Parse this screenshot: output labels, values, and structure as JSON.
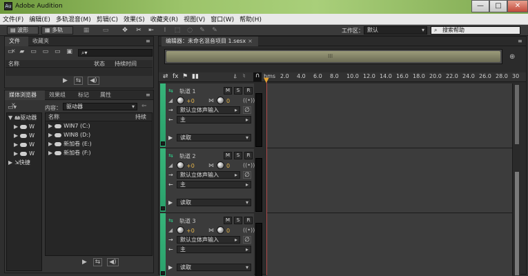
{
  "window": {
    "title": "Adobe Audition",
    "app_icon_text": "Au",
    "controls": [
      "—",
      "□",
      "✕"
    ]
  },
  "menu": [
    "文件(F)",
    "编辑(E)",
    "多轨混音(M)",
    "剪辑(C)",
    "效果(S)",
    "收藏夹(R)",
    "视图(V)",
    "窗口(W)",
    "帮助(H)"
  ],
  "toolbar": {
    "waveform_label": "波形",
    "multitrack_label": "多轨",
    "workspace_label": "工作区：",
    "workspace_value": "默认",
    "search_placeholder": "搜索帮助"
  },
  "files_panel": {
    "tabs": [
      "文件",
      "收藏夹"
    ],
    "columns": {
      "name": "名称",
      "status": "状态",
      "duration": "持续时间"
    }
  },
  "browser_panel": {
    "tabs": [
      "媒体浏览器",
      "效果组",
      "标记",
      "属性"
    ],
    "content_label": "内容：",
    "content_value": "驱动器",
    "left_tree": [
      "驱动器",
      "W",
      "W",
      "W",
      "W",
      "快捷"
    ],
    "columns": {
      "name": "名称",
      "duration": "持续"
    },
    "drives": [
      "WIN7 (C:)",
      "WIN8 (D:)",
      "新加卷 (E:)",
      "新加卷 (F:)"
    ]
  },
  "editor": {
    "tab_label": "编辑器：未命名混音项目 1.sesx",
    "ruler": [
      "hms",
      "2.0",
      "4.0",
      "6.0",
      "8.0",
      "10.0",
      "12.0",
      "14.0",
      "16.0",
      "18.0",
      "20.0",
      "22.0",
      "24.0",
      "26.0",
      "28.0",
      "30"
    ],
    "tracks": [
      {
        "name": "轨道 1",
        "volume": "+0",
        "pan": "0",
        "input": "默认立体声输入",
        "output": "主",
        "read": "读取"
      },
      {
        "name": "轨道 2",
        "volume": "+0",
        "pan": "0",
        "input": "默认立体声输入",
        "output": "主",
        "read": "读取"
      },
      {
        "name": "轨道 3",
        "volume": "+0",
        "pan": "0",
        "input": "默认立体声输入",
        "output": "主",
        "read": "读取"
      }
    ],
    "track_buttons": [
      "M",
      "S",
      "R"
    ]
  }
}
